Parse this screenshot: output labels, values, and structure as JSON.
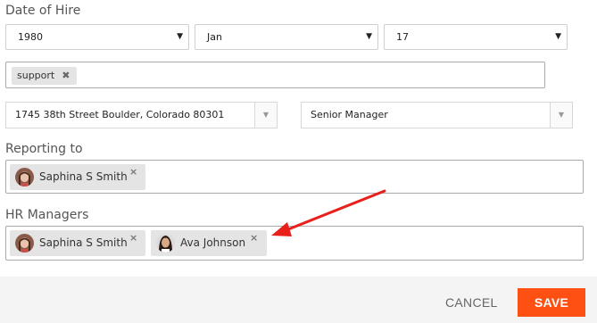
{
  "date_of_hire": {
    "label": "Date of Hire",
    "year": "1980",
    "month": "Jan",
    "day": "17",
    "caret": "▼"
  },
  "tags": {
    "items": [
      {
        "label": "support",
        "remove": "✖"
      }
    ]
  },
  "location": {
    "value": "1745 38th Street Boulder, Colorado 80301",
    "arrow": "▼"
  },
  "position": {
    "value": "Senior Manager",
    "arrow": "▼"
  },
  "reporting_to": {
    "label": "Reporting to",
    "people": [
      {
        "name": "Saphina S Smith",
        "remove": "×"
      }
    ]
  },
  "hr_managers": {
    "label": "HR Managers",
    "people": [
      {
        "name": "Saphina S Smith",
        "remove": "×"
      },
      {
        "name": "Ava Johnson",
        "remove": "×"
      }
    ]
  },
  "footer": {
    "cancel_label": "CANCEL",
    "save_label": "SAVE"
  },
  "colors": {
    "accent": "#ff5014",
    "annotation_arrow": "#e8201c"
  }
}
